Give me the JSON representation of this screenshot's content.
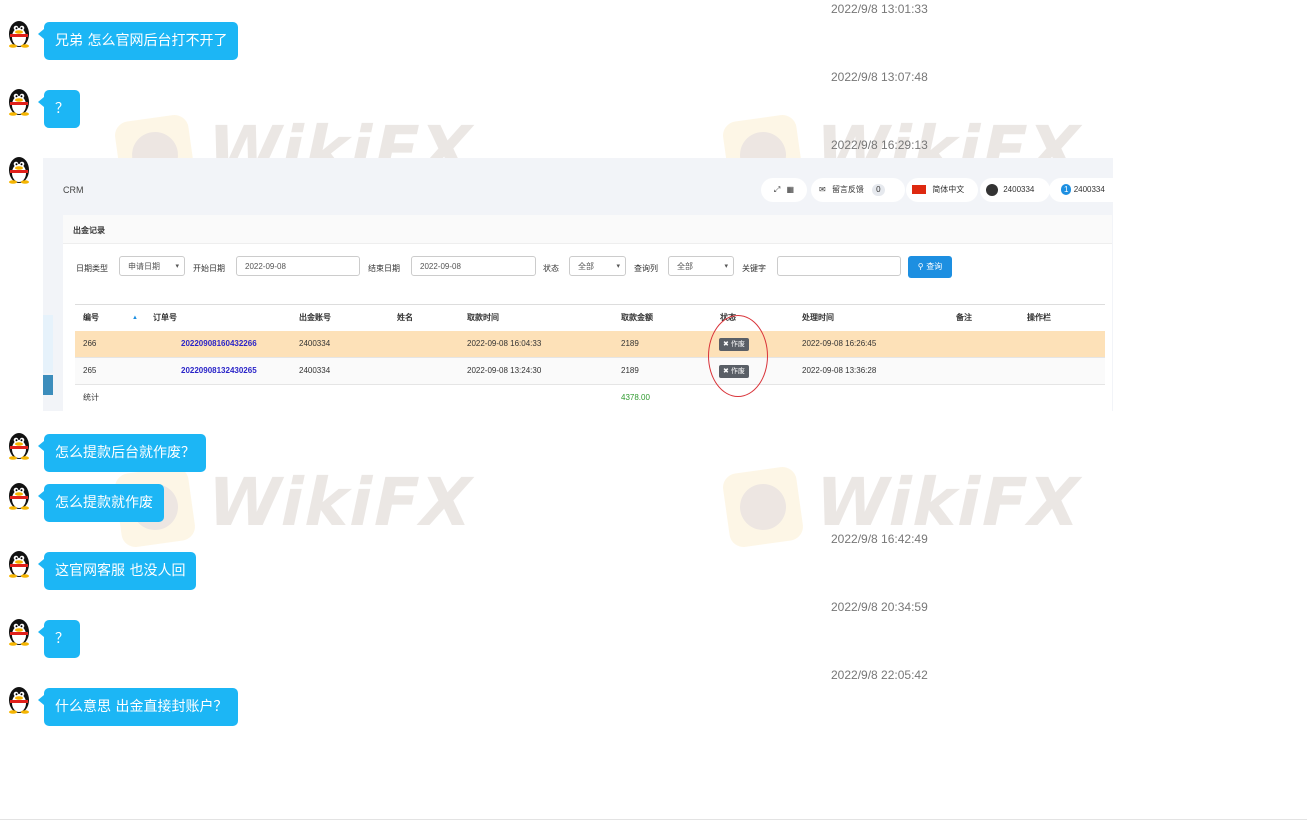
{
  "messages": [
    {
      "time": "2022/9/8 13:01:33",
      "text": "兄弟 怎么官网后台打不开了"
    },
    {
      "time": "2022/9/8 13:07:48",
      "text": "？"
    },
    {
      "time": "2022/9/8 16:29:13",
      "text": ""
    },
    {
      "time": "",
      "text": "怎么提款后台就作废？"
    },
    {
      "time": "",
      "text": "怎么提款就作废"
    },
    {
      "time": "2022/9/8 16:42:49",
      "text": "这官网客服 也没人回"
    },
    {
      "time": "2022/9/8 20:34:59",
      "text": "？"
    },
    {
      "time": "2022/9/8 22:05:42",
      "text": "什么意思 出金直接封账户？"
    }
  ],
  "watermark": {
    "text": "WikiFX"
  },
  "crm": {
    "app_name": "CRM",
    "toolbar": {
      "feedback_label": "留言反馈",
      "feedback_count": "0",
      "language": "简体中文",
      "account": "2400334",
      "account2": "2400334",
      "notif_count": "1"
    },
    "panel_title": "出金记录",
    "filters": {
      "date_type_label": "日期类型",
      "date_type_value": "申请日期",
      "start_label": "开始日期",
      "start_value": "2022-09-08",
      "end_label": "结束日期",
      "end_value": "2022-09-08",
      "status_label": "状态",
      "status_value": "全部",
      "query_col_label": "查询列",
      "query_col_value": "全部",
      "keyword_label": "关键字",
      "keyword_value": "",
      "search_label": "查询"
    },
    "table": {
      "headers": [
        "编号",
        "订单号",
        "出金账号",
        "姓名",
        "取款时间",
        "取款金额",
        "状态",
        "处理时间",
        "备注",
        "操作栏"
      ],
      "rows": [
        {
          "id": "266",
          "order": "20220908160432266",
          "account": "2400334",
          "name": "",
          "time": "2022-09-08 16:04:33",
          "amount": "2189",
          "status": "作废",
          "processed": "2022-09-08 16:26:45"
        },
        {
          "id": "265",
          "order": "20220908132430265",
          "account": "2400334",
          "name": "",
          "time": "2022-09-08 13:24:30",
          "amount": "2189",
          "status": "作废",
          "processed": "2022-09-08 13:36:28"
        }
      ],
      "total_label": "统计",
      "total_amount": "4378.00"
    }
  },
  "colors": {
    "bubble": "#1cb6f5",
    "highlight_row": "#fde1b8",
    "annotation": "#d9343a",
    "primary": "#1d8fe1"
  }
}
